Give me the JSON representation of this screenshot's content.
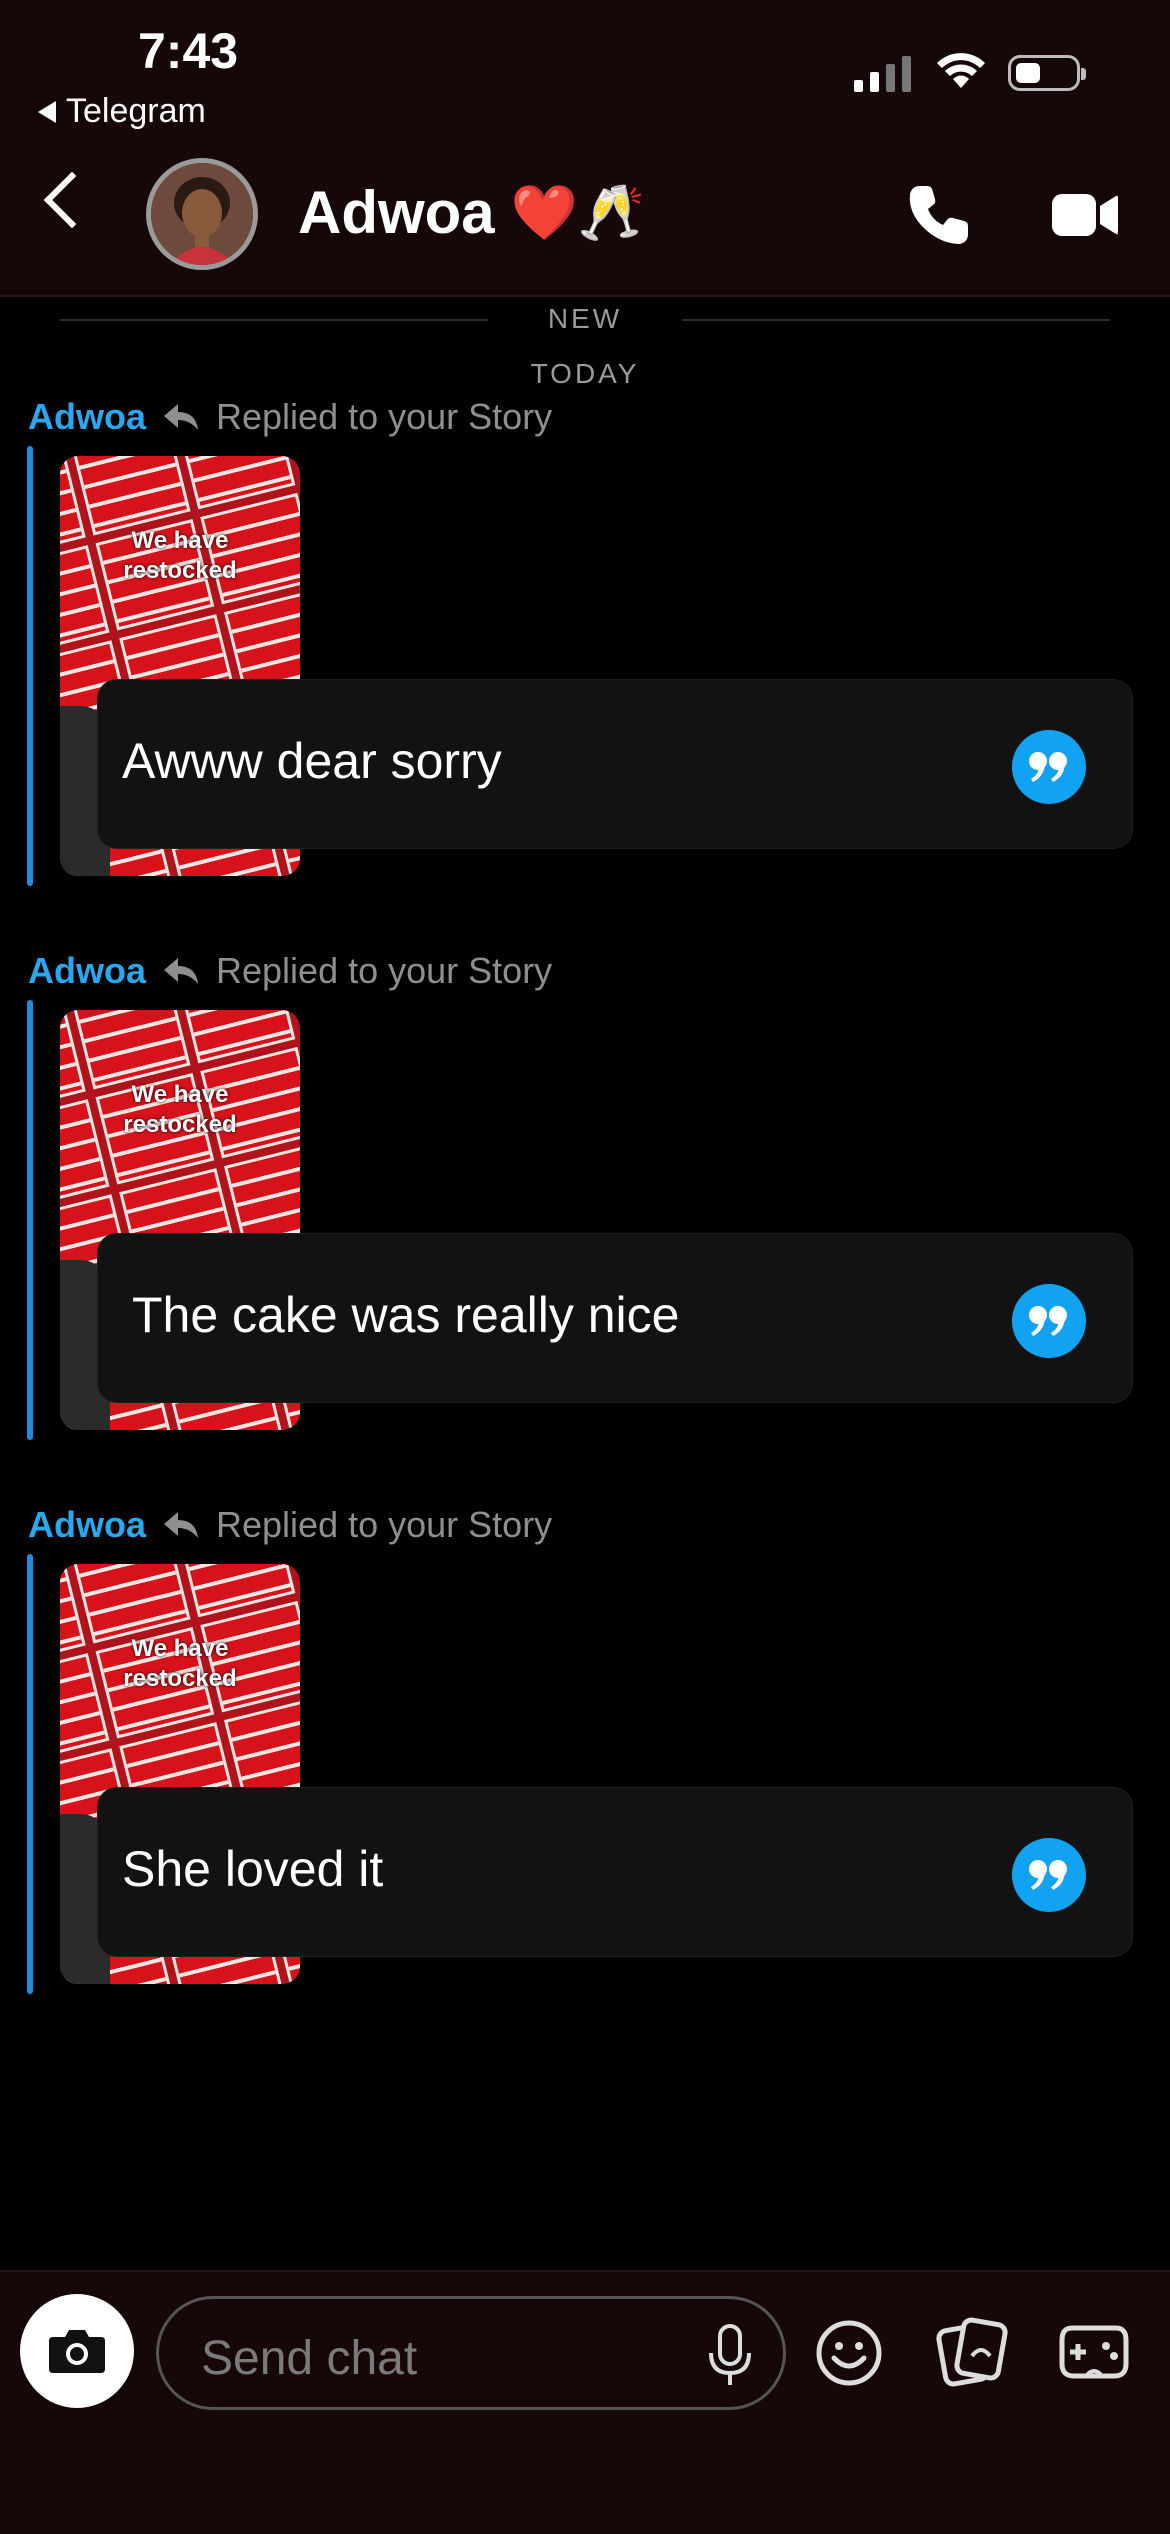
{
  "status_bar": {
    "time": "7:43",
    "back_app_label": "Telegram"
  },
  "header": {
    "contact_name": "Adwoa",
    "name_emojis": "❤️🥂"
  },
  "separators": {
    "new_label": "NEW",
    "today_label": "TODAY"
  },
  "messages": [
    {
      "sender": "Adwoa",
      "note": "Replied to your Story",
      "story_caption_line1": "We have",
      "story_caption_line2": "restocked",
      "text": "Awww dear sorry"
    },
    {
      "sender": "Adwoa",
      "note": "Replied to your Story",
      "story_caption_line1": "We have",
      "story_caption_line2": "restocked",
      "text": "The cake was really nice"
    },
    {
      "sender": "Adwoa",
      "note": "Replied to your Story",
      "story_caption_line1": "We have",
      "story_caption_line2": "restocked",
      "text": "She loved it"
    }
  ],
  "composer": {
    "placeholder": "Send chat"
  },
  "icons": {
    "back": "chevron-left-icon",
    "call": "phone-icon",
    "video": "video-camera-icon",
    "reply": "reply-arrow-icon",
    "quote": "quote-icon",
    "camera": "camera-icon",
    "mic": "microphone-icon",
    "emoji": "smiley-icon",
    "memories": "memories-icon",
    "games": "gamepad-icon"
  },
  "colors": {
    "accent_blue": "#2aa8ef",
    "header_bg": "#160809",
    "bubble_bg": "#121212"
  }
}
